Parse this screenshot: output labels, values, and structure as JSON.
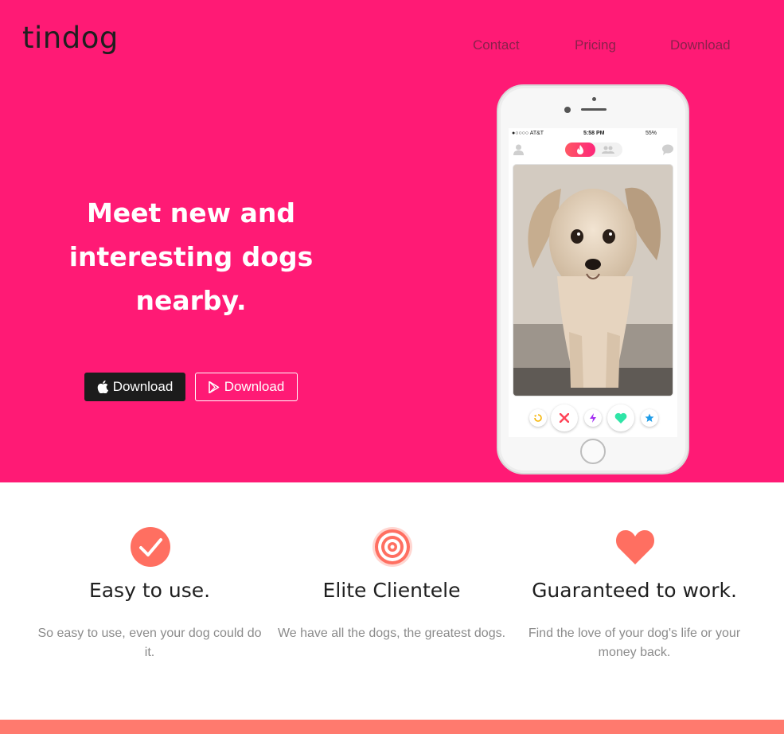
{
  "brand": {
    "name": "tindog"
  },
  "nav": {
    "items": [
      {
        "label": "Contact"
      },
      {
        "label": "Pricing"
      },
      {
        "label": "Download"
      }
    ]
  },
  "hero": {
    "headline_lines": [
      "Meet new and",
      "interesting dogs",
      "nearby."
    ],
    "background_color": "#ff1a75",
    "buttons": [
      {
        "label": "Download",
        "icon": "apple-icon",
        "style": "dark"
      },
      {
        "label": "Download",
        "icon": "google-play-icon",
        "style": "outline"
      }
    ],
    "phone": {
      "carrier": "●○○○○ AT&T",
      "time": "5:58 PM",
      "battery": "55%",
      "image": "dog-photo"
    }
  },
  "features": [
    {
      "icon": "checkmark-circle-icon",
      "title": "Easy to use.",
      "description": "So easy to use, even your dog could do it."
    },
    {
      "icon": "bullseye-target-icon",
      "title": "Elite Clientele",
      "description": "We have all the dogs, the greatest dogs."
    },
    {
      "icon": "heart-icon",
      "title": "Guaranteed to work.",
      "description": "Find the love of your dog's life or your money back."
    }
  ],
  "colors": {
    "accent": "#ff1a75",
    "icon": "#ff6f61",
    "footer": "#ff7a6e"
  }
}
